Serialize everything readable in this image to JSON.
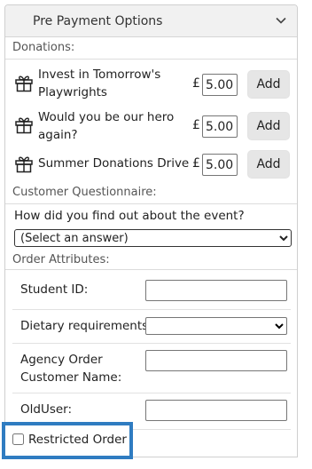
{
  "header": {
    "title": "Pre Payment Options",
    "toggle_icon": "chevron-down-icon"
  },
  "donations": {
    "label": "Donations:",
    "currency": "£",
    "items": [
      {
        "name": "Invest in Tomorrow's Playwrights",
        "amount": "5.00",
        "button": "Add",
        "icon": "gift-icon"
      },
      {
        "name": "Would you be our hero again?",
        "amount": "5.00",
        "button": "Add",
        "icon": "gift-icon"
      },
      {
        "name": "Summer Donations Drive",
        "amount": "5.00",
        "button": "Add",
        "icon": "gift-icon"
      }
    ]
  },
  "questionnaire": {
    "label": "Customer Questionnaire:",
    "question": "How did you find out about the event?",
    "selected": "(Select an answer)"
  },
  "order_attributes": {
    "label": "Order Attributes:",
    "fields": [
      {
        "label": "Student ID:",
        "value": ""
      },
      {
        "label": "Dietary requirements:",
        "value": ""
      },
      {
        "label": "Agency Order Customer Name:",
        "value": ""
      },
      {
        "label": "OldUser:",
        "value": ""
      }
    ]
  },
  "restricted": {
    "label": "Restricted Order",
    "checked": false,
    "highlight_color": "#2f7cc1"
  }
}
